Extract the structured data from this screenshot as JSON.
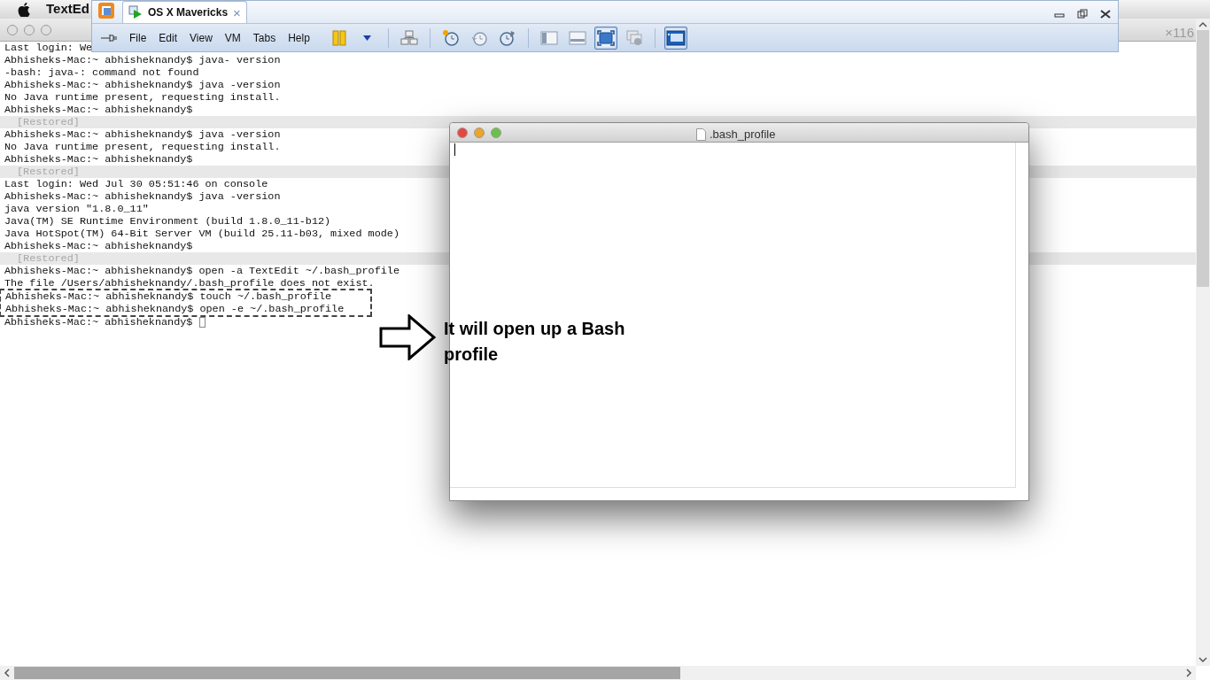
{
  "mac_menu_bar": {
    "app_name": "TextEd"
  },
  "terminal": {
    "size_label": "×116",
    "blocks": [
      {
        "kind": "plain",
        "lines": [
          {
            "kind": "text",
            "text": "Last login: We"
          },
          {
            "kind": "text",
            "text": "Abhisheks-Mac:~ abhisheknandy$ java- version"
          },
          {
            "kind": "text",
            "text": "-bash: java-: command not found"
          },
          {
            "kind": "text",
            "text": "Abhisheks-Mac:~ abhisheknandy$ java -version"
          },
          {
            "kind": "text",
            "text": "No Java runtime present, requesting install."
          },
          {
            "kind": "text",
            "text": "Abhisheks-Mac:~ abhisheknandy$"
          },
          {
            "kind": "restored",
            "text": "[Restored]"
          },
          {
            "kind": "text",
            "text": "Abhisheks-Mac:~ abhisheknandy$ java -version"
          },
          {
            "kind": "text",
            "text": "No Java runtime present, requesting install."
          },
          {
            "kind": "text",
            "text": "Abhisheks-Mac:~ abhisheknandy$"
          },
          {
            "kind": "restored",
            "text": "[Restored]"
          },
          {
            "kind": "text",
            "text": "Last login: Wed Jul 30 05:51:46 on console"
          },
          {
            "kind": "text",
            "text": "Abhisheks-Mac:~ abhisheknandy$ java -version"
          },
          {
            "kind": "text",
            "text": "java version \"1.8.0_11\""
          },
          {
            "kind": "text",
            "text": "Java(TM) SE Runtime Environment (build 1.8.0_11-b12)"
          },
          {
            "kind": "text",
            "text": "Java HotSpot(TM) 64-Bit Server VM (build 25.11-b03, mixed mode)"
          },
          {
            "kind": "text",
            "text": "Abhisheks-Mac:~ abhisheknandy$"
          },
          {
            "kind": "restored",
            "text": "[Restored]"
          },
          {
            "kind": "text",
            "text": "Abhisheks-Mac:~ abhisheknandy$ open -a TextEdit ~/.bash_profile"
          },
          {
            "kind": "text",
            "text": "The file /Users/abhisheknandy/.bash_profile does not exist."
          }
        ]
      },
      {
        "kind": "boxed",
        "lines": [
          {
            "kind": "text",
            "text": "Abhisheks-Mac:~ abhisheknandy$ touch ~/.bash_profile"
          },
          {
            "kind": "text",
            "text": "Abhisheks-Mac:~ abhisheknandy$ open -e ~/.bash_profile"
          }
        ]
      },
      {
        "kind": "plain",
        "lines": [
          {
            "kind": "cursor",
            "text": "Abhisheks-Mac:~ abhisheknandy$"
          }
        ]
      }
    ]
  },
  "vmware": {
    "tab": {
      "label": "OS X Mavericks",
      "selected": true,
      "close": "×"
    },
    "menu": [
      "File",
      "Edit",
      "View",
      "VM",
      "Tabs",
      "Help"
    ],
    "toolbar": [
      {
        "kind": "pause",
        "selected": false
      },
      {
        "kind": "caret",
        "selected": false
      },
      {
        "kind": "separator"
      },
      {
        "kind": "network",
        "selected": false
      },
      {
        "kind": "separator"
      },
      {
        "kind": "snapshot-take",
        "selected": false
      },
      {
        "kind": "snapshot-revert",
        "selected": false
      },
      {
        "kind": "snapshot-manage",
        "selected": false
      },
      {
        "kind": "separator"
      },
      {
        "kind": "sidebar",
        "selected": false
      },
      {
        "kind": "bottom-bar",
        "selected": false
      },
      {
        "kind": "fullscreen",
        "selected": true
      },
      {
        "kind": "unity",
        "selected": false
      },
      {
        "kind": "separator"
      },
      {
        "kind": "console",
        "selected": true
      }
    ]
  },
  "textedit": {
    "title": ".bash_profile"
  },
  "annotation": {
    "text": "It will open up a Bash profile"
  }
}
